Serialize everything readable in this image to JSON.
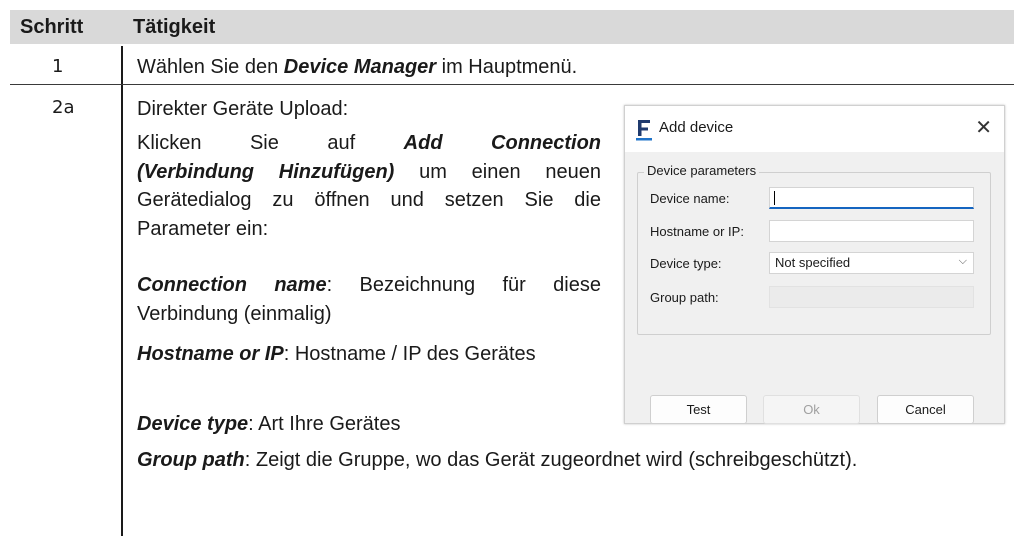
{
  "table": {
    "headers": [
      "Schritt",
      "Tätigkeit"
    ],
    "rows": [
      {
        "step": "1",
        "text_pre": "Wählen Sie den ",
        "text_bold": "Device Manager",
        "text_post": " im Hauptmenü."
      },
      {
        "step": "2a"
      }
    ]
  },
  "step2a": {
    "intro": "Direkter Geräte Upload:",
    "p1_line1_words": [
      "Klicken",
      "Sie",
      "auf"
    ],
    "p1_bold_a": "Add",
    "p1_bold_b": "Connection",
    "p1_bold_c": "(Verbindung Hinzufügen)",
    "p1_rest": " um einen neuen Gerätedialog zu öffnen und setzen Sie die Parameter ein:",
    "p2_bold": "Connection name",
    "p2_rest": ": Bezeichnung für diese Verbindung (einmalig)",
    "p3_bold": "Hostname or IP",
    "p3_rest": ": Hostname / IP des Gerätes",
    "p4_bold": "Device type",
    "p4_rest": ": Art Ihre Gerätes",
    "p5_bold": "Group path",
    "p5_rest": ": Zeigt die Gruppe, wo das Gerät zugeordnet wird (schreibgeschützt)."
  },
  "dialog": {
    "title": "Add device",
    "close_glyph": "✕",
    "app_icon": "app-logo-icon",
    "group_label": "Device parameters",
    "fields": {
      "device_name_label": "Device name:",
      "device_name_value": "",
      "hostname_label": "Hostname or IP:",
      "hostname_value": "",
      "device_type_label": "Device type:",
      "device_type_value": "Not specified",
      "group_path_label": "Group path:",
      "group_path_value": ""
    },
    "buttons": {
      "test": "Test",
      "ok": "Ok",
      "cancel": "Cancel"
    },
    "colors": {
      "accent": "#1565c0",
      "header_bg": "#d9d9d9",
      "dialog_body_bg": "#f0f0f0"
    }
  }
}
